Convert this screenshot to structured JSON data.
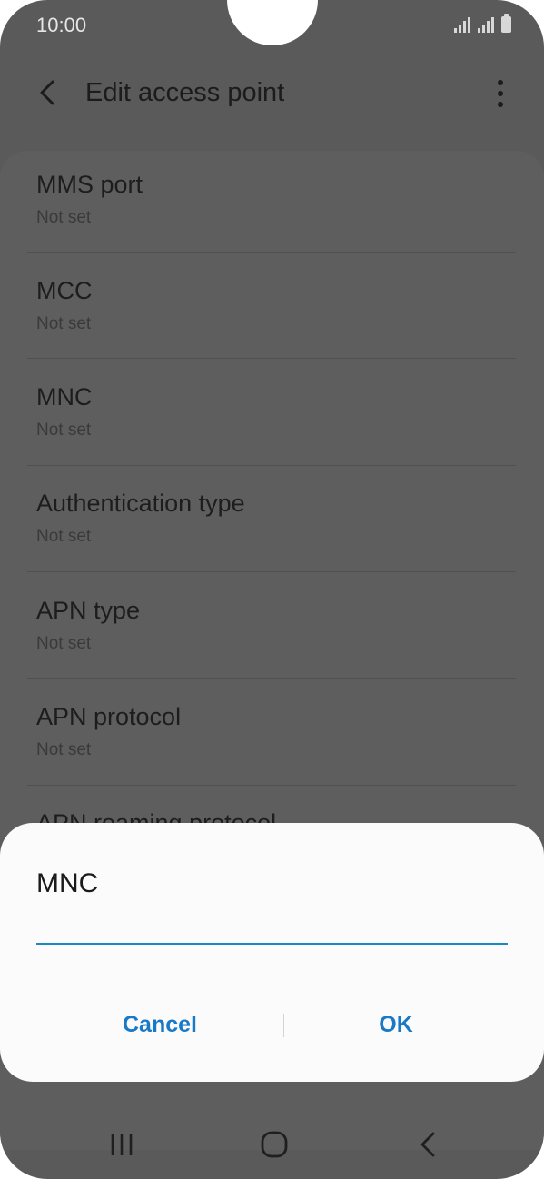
{
  "status_bar": {
    "time": "10:00",
    "icons": [
      "signal-icon",
      "signal-icon",
      "battery-icon"
    ]
  },
  "app_bar": {
    "title": "Edit access point",
    "back_icon": "back-arrow-icon",
    "more_icon": "more-vertical-icon"
  },
  "settings": {
    "items": [
      {
        "title": "MMS port",
        "value": "Not set"
      },
      {
        "title": "MCC",
        "value": "Not set"
      },
      {
        "title": "MNC",
        "value": "Not set"
      },
      {
        "title": "Authentication type",
        "value": "Not set"
      },
      {
        "title": "APN type",
        "value": "Not set"
      },
      {
        "title": "APN protocol",
        "value": "Not set"
      },
      {
        "title": "APN roaming protocol",
        "value": ""
      }
    ]
  },
  "dialog": {
    "title": "MNC",
    "input_value": "",
    "cancel_label": "Cancel",
    "ok_label": "OK",
    "accent_color": "#1979c9"
  },
  "nav_bar": {
    "icons": [
      "recent-apps-icon",
      "home-icon",
      "back-icon"
    ]
  },
  "colors": {
    "scrim": "#5a5a5a",
    "dialog_background": "#fbfbfb",
    "input_underline": "#1e88c6"
  }
}
